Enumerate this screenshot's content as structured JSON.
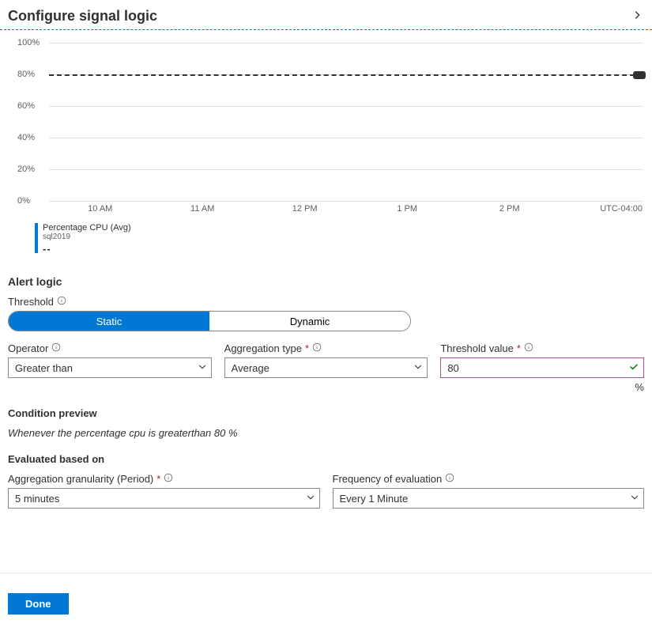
{
  "header": {
    "title": "Configure signal logic"
  },
  "chart_data": {
    "type": "line",
    "title": "",
    "xlabel": "",
    "ylabel": "",
    "ylim": [
      0,
      100
    ],
    "y_ticks": [
      "0%",
      "20%",
      "40%",
      "60%",
      "80%",
      "100%"
    ],
    "x_ticks": [
      "10 AM",
      "11 AM",
      "12 PM",
      "1 PM",
      "2 PM"
    ],
    "timezone": "UTC-04:00",
    "threshold": 80,
    "series": [
      {
        "name": "Percentage CPU (Avg)",
        "resource": "sql2019",
        "values": [],
        "current": "--"
      }
    ]
  },
  "alert_logic": {
    "heading": "Alert logic",
    "threshold_label": "Threshold",
    "threshold_mode": {
      "options": [
        "Static",
        "Dynamic"
      ],
      "selected": "Static"
    },
    "operator_label": "Operator",
    "operator_value": "Greater than",
    "aggregation_label": "Aggregation type",
    "aggregation_value": "Average",
    "threshold_value_label": "Threshold value",
    "threshold_value": "80",
    "threshold_unit": "%"
  },
  "condition_preview": {
    "heading": "Condition preview",
    "text": "Whenever the percentage cpu is greaterthan 80 %"
  },
  "evaluated": {
    "heading": "Evaluated based on",
    "granularity_label": "Aggregation granularity (Period)",
    "granularity_value": "5 minutes",
    "frequency_label": "Frequency of evaluation",
    "frequency_value": "Every 1 Minute"
  },
  "footer": {
    "done": "Done"
  }
}
